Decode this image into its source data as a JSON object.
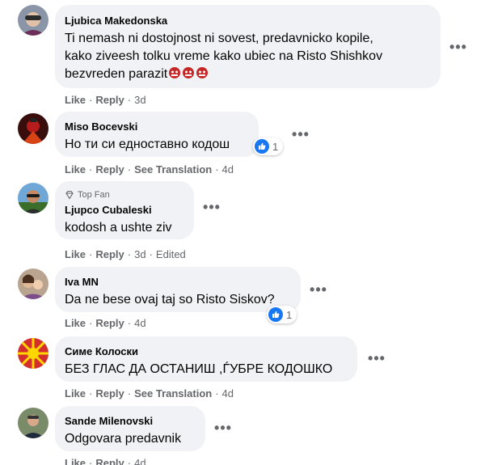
{
  "colors": {
    "bubble": "#f0f2f5",
    "muted": "#65676b",
    "like_blue": "#1877f2",
    "text": "#050505"
  },
  "comments": [
    {
      "author": "Ljubica Makedonska",
      "text_lines": [
        "Ti nemash ni dostojnost ni sovest, predavnicko kopile,",
        "kako ziveesh tolku vreme kako ubiec na Risto Shishkov",
        "bezvreden parazit"
      ],
      "emojis": [
        "ogre-face",
        "ogre-face",
        "ogre-face"
      ],
      "actions": {
        "like": "Like",
        "reply": "Reply",
        "time": "3d"
      }
    },
    {
      "author": "Miso Bocevski",
      "text": "Но ти си едноставно кодош",
      "reaction": {
        "icon": "like-icon",
        "count": "1"
      },
      "actions": {
        "like": "Like",
        "reply": "Reply",
        "translation": "See Translation",
        "time": "4d"
      }
    },
    {
      "badge": "Top Fan",
      "author": "Ljupco Cubaleski",
      "text": "kodosh a ushte ziv",
      "actions": {
        "like": "Like",
        "reply": "Reply",
        "time": "3d",
        "edited": "Edited"
      }
    },
    {
      "author": "Iva MN",
      "text": "Da ne bese ovaj taj so Risto Siskov?",
      "reaction": {
        "icon": "like-icon",
        "count": "1"
      },
      "actions": {
        "like": "Like",
        "reply": "Reply",
        "time": "4d"
      }
    },
    {
      "author": "Симе Колоски",
      "text": "БЕЗ ГЛАС ДА ОСТАНИШ ,ЃУБРЕ КОДОШКО",
      "actions": {
        "like": "Like",
        "reply": "Reply",
        "translation": "See Translation",
        "time": "4d"
      }
    },
    {
      "author": "Sande Milenovski",
      "text": "Odgovara predavnik",
      "actions": {
        "like": "Like",
        "reply": "Reply",
        "time": "4d"
      }
    }
  ]
}
